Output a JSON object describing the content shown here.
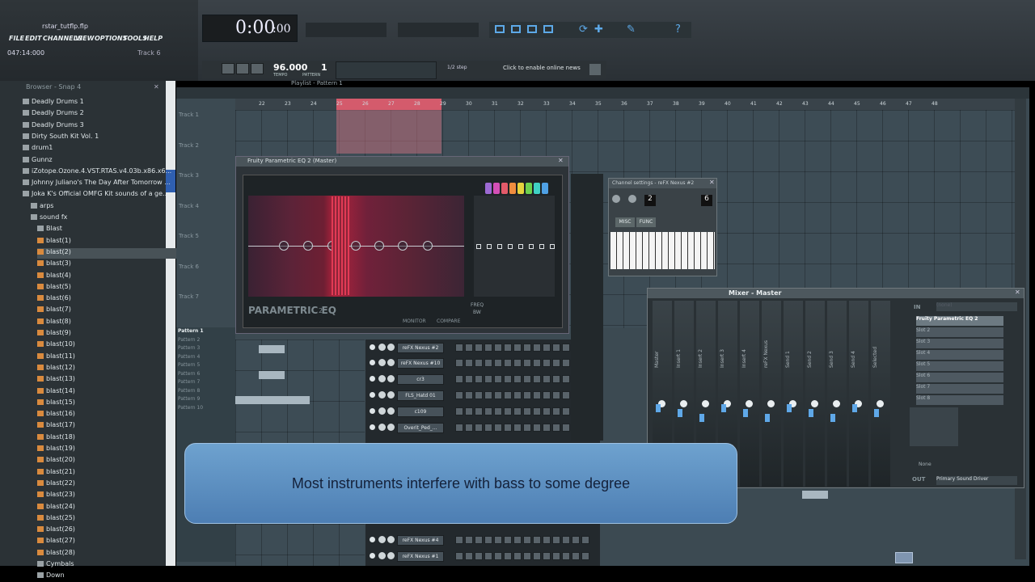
{
  "window": {
    "filename": "rstar_tutflp.flp",
    "time_counter": "047:14:000",
    "track_label": "Track 6"
  },
  "menu": [
    "FILE",
    "EDIT",
    "CHANNELS",
    "VIEW",
    "OPTIONS",
    "TOOLS",
    "HELP"
  ],
  "clock": {
    "time": "0:00",
    "subseconds": ":00"
  },
  "transport": {
    "tempo": "96.000",
    "tempo_label": "TEMPO",
    "pattern": "1",
    "pattern_label": "PATTERN",
    "snap": "1/2 step",
    "news": "Click to enable online news"
  },
  "browser": {
    "title": "Browser - Snap 4",
    "items": [
      {
        "label": "Deadly Drums 1",
        "type": "folder"
      },
      {
        "label": "Deadly Drums 2",
        "type": "folder"
      },
      {
        "label": "Deadly Drums 3",
        "type": "folder"
      },
      {
        "label": "Dirty South Kit Vol. 1",
        "type": "folder"
      },
      {
        "label": "drum1",
        "type": "folder"
      },
      {
        "label": "Gunnz",
        "type": "folder"
      },
      {
        "label": "iZotope.Ozone.4.VST.RTAS.v4.03b.x86.x6...",
        "type": "folder"
      },
      {
        "label": "Johnny Juliano's The Day After Tomorrow ...",
        "type": "folder"
      },
      {
        "label": "Joka K's Official OMFG Kit sounds of a ge...",
        "type": "folder"
      },
      {
        "label": "arps",
        "type": "folder"
      },
      {
        "label": "sound fx",
        "type": "folder"
      },
      {
        "label": "Blast",
        "type": "folder"
      },
      {
        "label": "blast(1)",
        "type": "file"
      },
      {
        "label": "blast(2)",
        "type": "file"
      },
      {
        "label": "blast(3)",
        "type": "file"
      },
      {
        "label": "blast(4)",
        "type": "file"
      },
      {
        "label": "blast(5)",
        "type": "file"
      },
      {
        "label": "blast(6)",
        "type": "file"
      },
      {
        "label": "blast(7)",
        "type": "file"
      },
      {
        "label": "blast(8)",
        "type": "file"
      },
      {
        "label": "blast(9)",
        "type": "file"
      },
      {
        "label": "blast(10)",
        "type": "file"
      },
      {
        "label": "blast(11)",
        "type": "file"
      },
      {
        "label": "blast(12)",
        "type": "file"
      },
      {
        "label": "blast(13)",
        "type": "file"
      },
      {
        "label": "blast(14)",
        "type": "file"
      },
      {
        "label": "blast(15)",
        "type": "file"
      },
      {
        "label": "blast(16)",
        "type": "file"
      },
      {
        "label": "blast(17)",
        "type": "file"
      },
      {
        "label": "blast(18)",
        "type": "file"
      },
      {
        "label": "blast(19)",
        "type": "file"
      },
      {
        "label": "blast(20)",
        "type": "file"
      },
      {
        "label": "blast(21)",
        "type": "file"
      },
      {
        "label": "blast(22)",
        "type": "file"
      },
      {
        "label": "blast(23)",
        "type": "file"
      },
      {
        "label": "blast(24)",
        "type": "file"
      },
      {
        "label": "blast(25)",
        "type": "file"
      },
      {
        "label": "blast(26)",
        "type": "file"
      },
      {
        "label": "blast(27)",
        "type": "file"
      },
      {
        "label": "blast(28)",
        "type": "file"
      },
      {
        "label": "Cymbals",
        "type": "folder"
      },
      {
        "label": "Down",
        "type": "folder"
      }
    ]
  },
  "playlist": {
    "title": "Playlist - Pattern 1",
    "tracks": [
      "Track 1",
      "Track 2",
      "Track 3",
      "Track 4",
      "Track 5",
      "Track 6",
      "Track 7"
    ],
    "patterns": [
      "Pattern 1",
      "Pattern 2",
      "Pattern 3",
      "Pattern 4",
      "Pattern 5",
      "Pattern 6",
      "Pattern 7",
      "Pattern 8",
      "Pattern 9",
      "Pattern 10"
    ],
    "bar_numbers": [
      "22",
      "23",
      "24",
      "25",
      "26",
      "27",
      "28",
      "29",
      "30",
      "31",
      "32",
      "33",
      "34",
      "35",
      "36",
      "37",
      "38",
      "39",
      "40",
      "41",
      "42",
      "43",
      "44",
      "45",
      "46",
      "47",
      "48"
    ]
  },
  "eq": {
    "title": "Fruity Parametric EQ 2 (Master)",
    "logo": "PARAMETRIC EQ",
    "logo_sup": "2",
    "monitor": "MONITOR",
    "compare": "COMPARE",
    "freq": "FREQ",
    "bw": "BW"
  },
  "channels": [
    "reFX Nexus #2",
    "reFX Nexus #10",
    "cr3",
    "FLS_Hatd 01",
    "c109",
    "Overit_Ped_...",
    "reFX Nexus #4",
    "reFX Nexus #1"
  ],
  "nexus": {
    "title": "Channel settings - reFX Nexus #2",
    "misc": "MISC",
    "func": "FUNC",
    "num1": "2",
    "num2": "6"
  },
  "mixer": {
    "title": "Mixer - Master",
    "strips": [
      "Master",
      "Insert 1",
      "Insert 2",
      "Insert 3",
      "Insert 4",
      "reFX Nexus",
      "Send 1",
      "Send 2",
      "Send 3",
      "Send 4",
      "Selected"
    ],
    "in_label": "IN",
    "in_value": "(none)",
    "slot1": "Fruity Parametric EQ 2",
    "slots": [
      "Slot 2",
      "Slot 3",
      "Slot 4",
      "Slot 5",
      "Slot 6",
      "Slot 7",
      "Slot 8"
    ],
    "out_label": "OUT",
    "out_value": "Primary Sound Driver",
    "none_label": "None"
  },
  "caption": "Most instruments interfere with bass to some degree",
  "colors": {
    "accent": "#d4324c",
    "caption_bg": "#5b8ec2"
  }
}
